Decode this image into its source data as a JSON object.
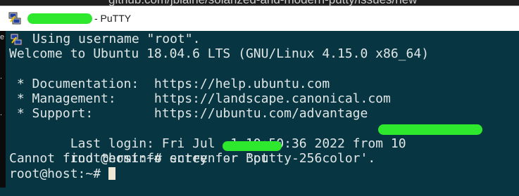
{
  "background": {
    "url_text": "github.com/jblaine/solarized-and-modern-putty/issues/new"
  },
  "window": {
    "title": "- PuTTY",
    "icon": "putty-icon"
  },
  "terminal": {
    "lines": [
      "Using username \"root\".",
      "Welcome to Ubuntu 18.04.6 LTS (GNU/Linux 4.15.0 x86_64)",
      "",
      " * Documentation:  https://help.ubuntu.com",
      " * Management:     https://landscape.canonical.com",
      " * Support:        https://ubuntu.com/advantage",
      "Last login: Fri Jul  1 10:50:36 2022 from 10",
      "root@host:~# screen -r Bot",
      "Cannot find terminfo entry for 'putty-256color'.",
      "root@host:~# "
    ]
  },
  "colors": {
    "terminal_bg": "#073642",
    "terminal_fg": "#e0e6e6",
    "redaction": "#2ee82e",
    "cursor": "#eee8d5"
  }
}
